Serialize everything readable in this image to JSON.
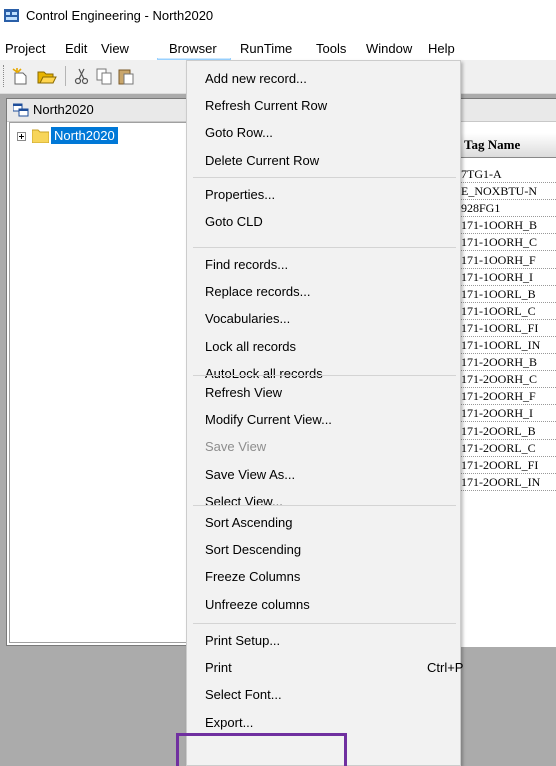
{
  "window": {
    "title": "Control Engineering - North2020",
    "app_icon": "app-icon"
  },
  "menubar": {
    "items": [
      {
        "label": "Project"
      },
      {
        "label": "Edit"
      },
      {
        "label": "View"
      },
      {
        "label": "Browser"
      },
      {
        "label": "RunTime"
      },
      {
        "label": "Tools"
      },
      {
        "label": "Window"
      },
      {
        "label": "Help"
      }
    ],
    "open_menu": "Browser"
  },
  "toolbar": {
    "icons": [
      "new-icon",
      "open-folder-icon",
      "cut-icon",
      "copy-icon",
      "paste-icon"
    ]
  },
  "tree": {
    "header_label": "North2020",
    "node_label": "North2020",
    "node_selected": true
  },
  "grid": {
    "column_header": "Tag Name",
    "rows": [
      "7TG1-A",
      "E_NOXBTU-N",
      "928FG1",
      "171-1OORH_B",
      "171-1OORH_C",
      "171-1OORH_F",
      "171-1OORH_I",
      "171-1OORL_B",
      "171-1OORL_C",
      "171-1OORL_FI",
      "171-1OORL_IN",
      "171-2OORH_B",
      "171-2OORH_C",
      "171-2OORH_F",
      "171-2OORH_I",
      "171-2OORL_B",
      "171-2OORL_C",
      "171-2OORL_FI",
      "171-2OORL_IN"
    ]
  },
  "browser_menu": {
    "groups": [
      [
        {
          "label": "Add new record..."
        },
        {
          "label": "Refresh Current Row"
        },
        {
          "label": "Goto Row..."
        },
        {
          "label": "Delete Current Row"
        }
      ],
      [
        {
          "label": "Properties..."
        },
        {
          "label": "Goto CLD"
        }
      ],
      [
        {
          "label": "Find records..."
        },
        {
          "label": "Replace records..."
        },
        {
          "label": "Vocabularies..."
        },
        {
          "label": "Lock all records"
        },
        {
          "label": "AutoLock all records"
        }
      ],
      [
        {
          "label": "Refresh View"
        },
        {
          "label": "Modify Current View..."
        },
        {
          "label": "Save View",
          "disabled": true
        },
        {
          "label": "Save View As..."
        },
        {
          "label": "Select View..."
        }
      ],
      [
        {
          "label": "Sort Ascending"
        },
        {
          "label": "Sort Descending"
        },
        {
          "label": "Freeze Columns"
        },
        {
          "label": "Unfreeze columns"
        }
      ],
      [
        {
          "label": "Print Setup..."
        },
        {
          "label": "Print",
          "accelerator": "Ctrl+P"
        },
        {
          "label": "Select Font..."
        },
        {
          "label": "Export...",
          "highlighted_annotation": true
        }
      ]
    ]
  },
  "colors": {
    "menu_highlight": "#cce8ff",
    "tree_selection": "#0078d7",
    "annotation_box": "#7030a0",
    "mdi_background": "#ababab"
  }
}
